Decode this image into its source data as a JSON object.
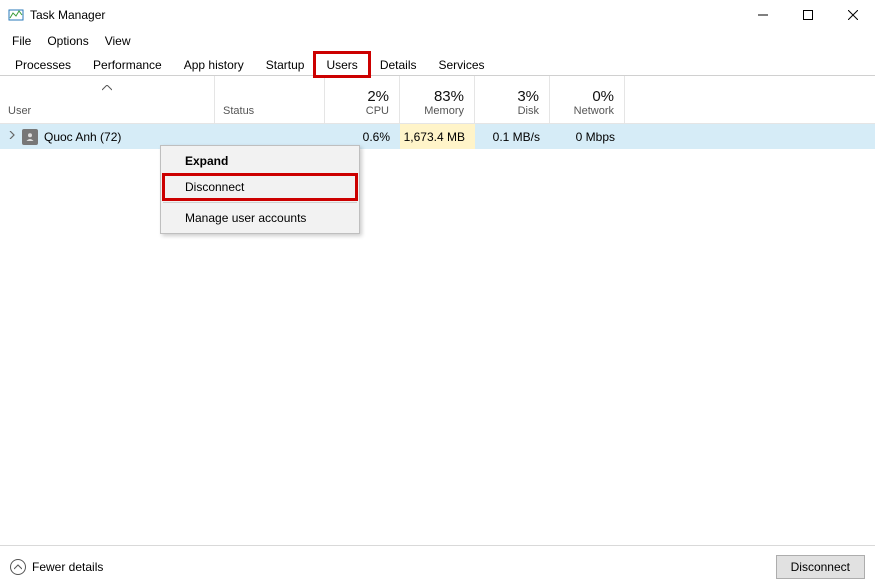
{
  "window": {
    "title": "Task Manager"
  },
  "menu": {
    "file": "File",
    "options": "Options",
    "view": "View"
  },
  "tabs": {
    "processes": "Processes",
    "performance": "Performance",
    "app_history": "App history",
    "startup": "Startup",
    "users": "Users",
    "details": "Details",
    "services": "Services"
  },
  "columns": {
    "user": "User",
    "status": "Status",
    "cpu": {
      "pct": "2%",
      "label": "CPU"
    },
    "memory": {
      "pct": "83%",
      "label": "Memory"
    },
    "disk": {
      "pct": "3%",
      "label": "Disk"
    },
    "network": {
      "pct": "0%",
      "label": "Network"
    }
  },
  "rows": [
    {
      "name": "Quoc Anh (72)",
      "status": "",
      "cpu": "0.6%",
      "memory": "1,673.4 MB",
      "disk": "0.1 MB/s",
      "network": "0 Mbps"
    }
  ],
  "context_menu": {
    "expand": "Expand",
    "disconnect": "Disconnect",
    "manage": "Manage user accounts"
  },
  "footer": {
    "fewer": "Fewer details",
    "disconnect": "Disconnect"
  }
}
